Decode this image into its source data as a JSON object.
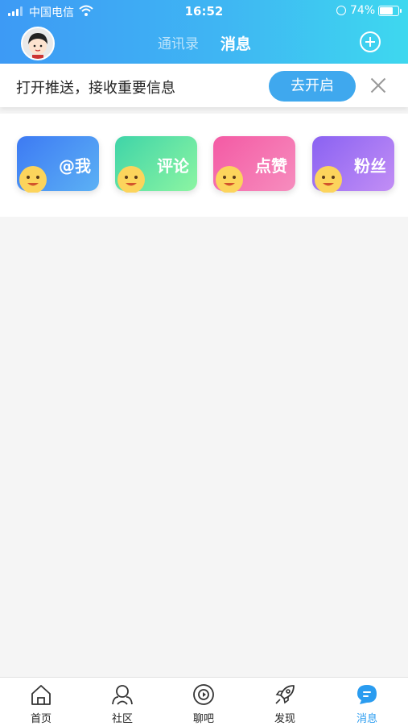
{
  "status_bar": {
    "carrier": "中国电信",
    "time": "16:52",
    "battery": "74%",
    "battery_level": 0.74
  },
  "header": {
    "avatar_icon": "user-avatar",
    "tabs": [
      {
        "label": "通讯录",
        "active": false
      },
      {
        "label": "消息",
        "active": true
      }
    ],
    "plus_icon": "plus-circle-icon"
  },
  "push_banner": {
    "text": "打开推送，接收重要信息",
    "button": "去开启",
    "close_icon": "close-icon"
  },
  "categories": [
    {
      "label": "@我",
      "icon": "emoji-face-icon"
    },
    {
      "label": "评论",
      "icon": "emoji-face-icon"
    },
    {
      "label": "点赞",
      "icon": "emoji-face-icon"
    },
    {
      "label": "粉丝",
      "icon": "emoji-face-icon"
    }
  ],
  "tabbar": [
    {
      "label": "首页",
      "icon": "home-icon"
    },
    {
      "label": "社区",
      "icon": "community-icon"
    },
    {
      "label": "聊吧",
      "icon": "chat-bar-icon"
    },
    {
      "label": "发现",
      "icon": "rocket-icon"
    },
    {
      "label": "消息",
      "icon": "message-icon",
      "active": true
    }
  ],
  "colors": {
    "accent": "#3fa8ee",
    "header_start": "#3d9af5",
    "header_end": "#3ed8ef",
    "tab_active": "#2a9cf0"
  }
}
